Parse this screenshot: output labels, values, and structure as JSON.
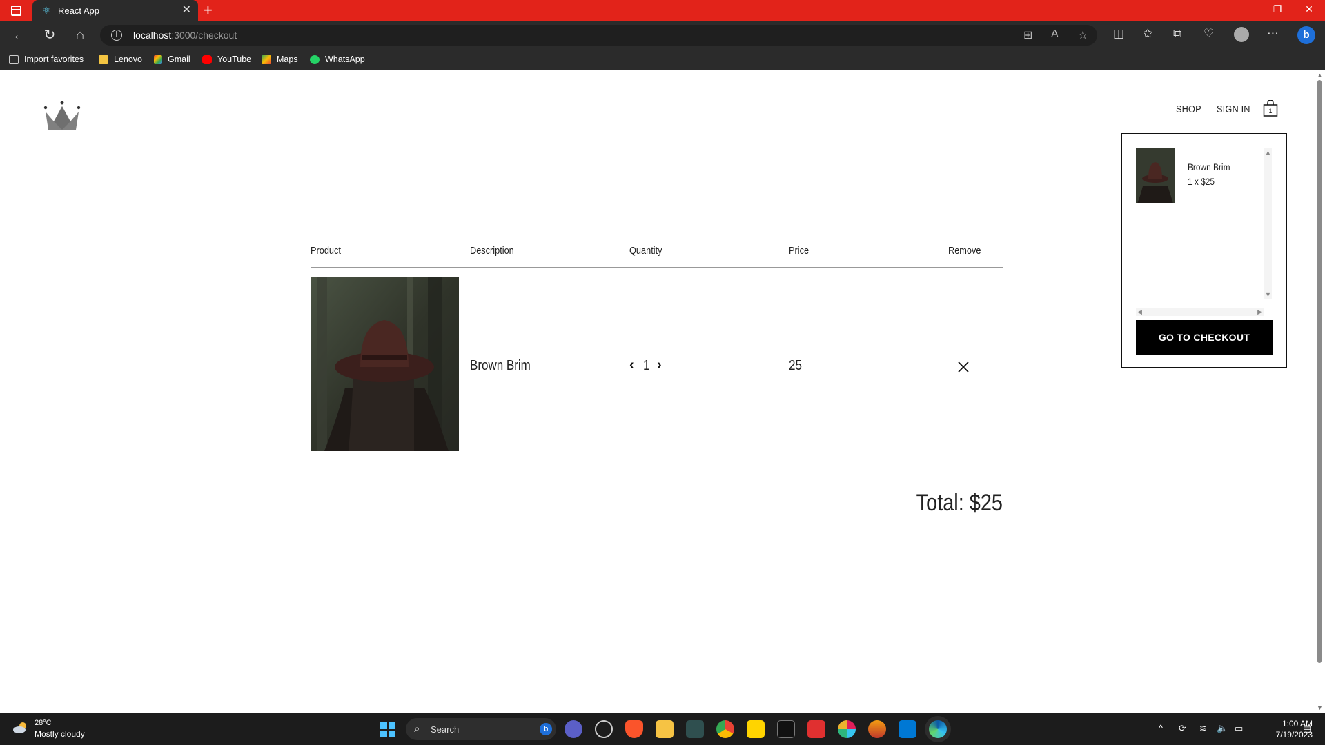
{
  "browser": {
    "tab_title": "React App",
    "url_host": "localhost",
    "url_path": ":3000/checkout",
    "bookmarks": [
      {
        "label": "Import favorites",
        "icon": "import-icon"
      },
      {
        "label": "Lenovo",
        "icon": "folder-icon"
      },
      {
        "label": "Gmail",
        "icon": "gmail-icon"
      },
      {
        "label": "YouTube",
        "icon": "youtube-icon"
      },
      {
        "label": "Maps",
        "icon": "maps-icon"
      },
      {
        "label": "WhatsApp",
        "icon": "whatsapp-icon"
      }
    ]
  },
  "header": {
    "nav": [
      {
        "label": "SHOP"
      },
      {
        "label": "SIGN IN"
      }
    ],
    "cart_count": "1"
  },
  "checkout": {
    "columns": [
      "Product",
      "Description",
      "Quantity",
      "Price",
      "Remove"
    ],
    "items": [
      {
        "name": "Brown Brim",
        "quantity": "1",
        "price": "25"
      }
    ],
    "total": "Total: $25"
  },
  "cart_dropdown": {
    "items": [
      {
        "name": "Brown Brim",
        "qty_price": "1 x $25"
      }
    ],
    "button_label": "GO TO CHECKOUT"
  },
  "taskbar": {
    "weather_temp": "28°C",
    "weather_desc": "Mostly cloudy",
    "search_placeholder": "Search",
    "time": "1:00 AM",
    "date": "7/19/2023"
  },
  "colors": {
    "titlebar": "#e2231a",
    "chrome": "#2b2b2b",
    "checkout_button": "#000000"
  }
}
